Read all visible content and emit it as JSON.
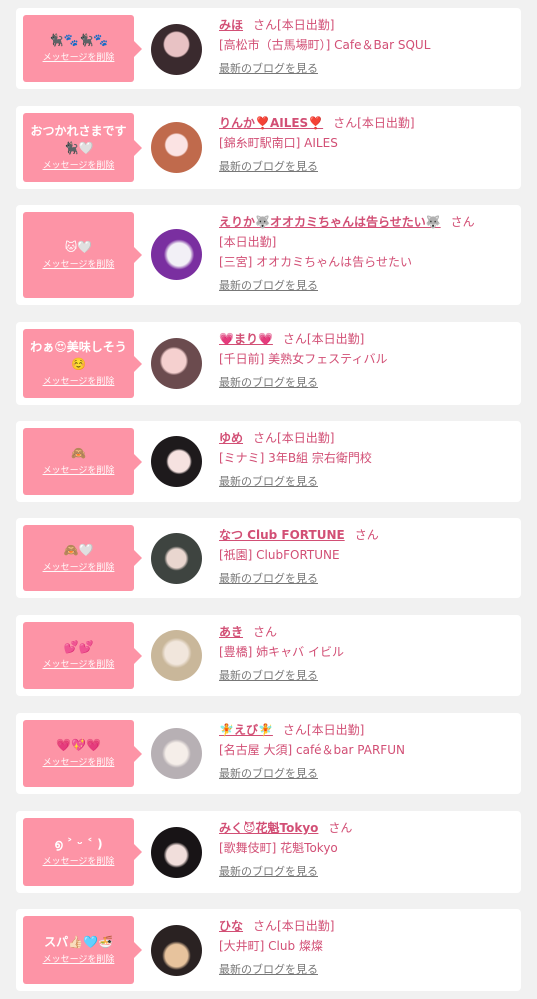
{
  "delete_label": "メッセージを削除",
  "blog_label": "最新のブログを見る",
  "colors": {
    "accent": "#d24f75",
    "bubble": "#fd94a6",
    "background": "#f1f1f1"
  },
  "messages": [
    {
      "message": "🐈‍⬛🐾🐈‍⬛🐾",
      "name": "みほ",
      "san": "さん",
      "status": "[本日出勤]",
      "shop_lines": [
        "[高松市（古馬場町）] Cafe＆Bar SQUL"
      ]
    },
    {
      "message": "おつかれさまです\n🐈‍⬛🤍",
      "name": "りんか❣️AILES❣️",
      "san": "さん",
      "status": "[本日出勤]",
      "shop_lines": [
        "[錦糸町駅南口] AILES"
      ]
    },
    {
      "message": "🐱🤍",
      "name": "えりか🐺オオカミちゃんは告らせたい🐺",
      "san": "さん",
      "status": "",
      "shop_lines": [
        "[本日出勤]",
        "[三宮] オオカミちゃんは告らせたい"
      ]
    },
    {
      "message": "わぁ😍美味しそう\n☺️",
      "name": "💗まり💗",
      "san": "さん",
      "status": "[本日出勤]",
      "shop_lines": [
        "[千日前] 美熟女フェスティバル"
      ]
    },
    {
      "message": "🙈",
      "name": "ゆめ",
      "san": "さん",
      "status": "[本日出勤]",
      "shop_lines": [
        "[ミナミ] 3年B組 宗右衛門校"
      ]
    },
    {
      "message": "🙈🤍",
      "name": "なつ Club FORTUNE",
      "san": "さん",
      "status": "",
      "shop_lines": [
        "[祇園] ClubFORTUNE"
      ]
    },
    {
      "message": "💕💕",
      "name": "あき",
      "san": "さん",
      "status": "",
      "shop_lines": [
        "[豊橋] 姉キャバ イビル"
      ]
    },
    {
      "message": "💗💖💗",
      "name": "🧚えび🧚",
      "san": "さん",
      "status": "[本日出勤]",
      "shop_lines": [
        "[名古屋 大須] café＆bar PARFUN"
      ]
    },
    {
      "message": "൭ ˃ ᵕ ˂ )",
      "name": "みく😈花魁Tokyo",
      "san": "さん",
      "status": "",
      "shop_lines": [
        "[歌舞伎町] 花魁Tokyo"
      ]
    },
    {
      "message": "スパ👍🏻🩵🍜",
      "name": "ひな",
      "san": "さん",
      "status": "[本日出勤]",
      "shop_lines": [
        "[大井町] Club 燦燦"
      ]
    }
  ]
}
